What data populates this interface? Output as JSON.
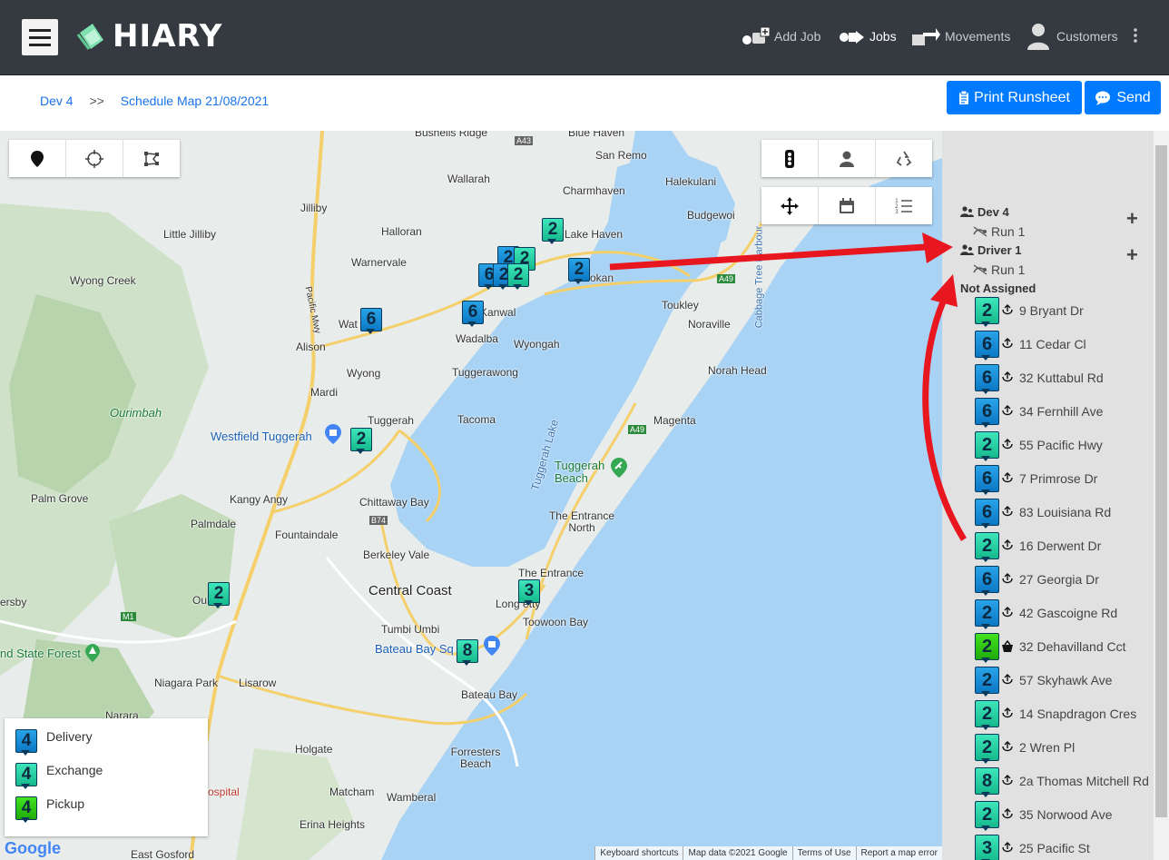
{
  "app": {
    "name": "HIARY"
  },
  "nav": {
    "add_job": "Add Job",
    "jobs": "Jobs",
    "movements": "Movements",
    "customers": "Customers"
  },
  "breadcrumb": {
    "parent": "Dev 4",
    "separator": ">>",
    "current": "Schedule Map 21/08/2021"
  },
  "actions": {
    "print": "Print Runsheet",
    "send": "Send"
  },
  "map": {
    "places": {
      "bushells_ridge": "Bushells Ridge",
      "blue_haven": "Blue Haven",
      "san_remo": "San Remo",
      "wallarah": "Wallarah",
      "charmhaven": "Charmhaven",
      "halekulani": "Halekulani",
      "jilliby": "Jilliby",
      "halloran": "Halloran",
      "lake_haven": "Lake Haven",
      "budgewoi": "Budgewoi",
      "little_jilliby": "Little Jilliby",
      "warnervale": "Warnervale",
      "wyong_creek": "Wyong Creek",
      "gorokan": "okan",
      "toukley": "Toukley",
      "watanobbi": "Wat   obbi",
      "kanwal": "Kanwal",
      "noraville": "Noraville",
      "alison": "Alison",
      "wadalba": "Wadalba",
      "wyongah": "Wyongah",
      "wyong": "Wyong",
      "tuggerawong": "Tuggerawong",
      "norah_head": "Norah Head",
      "mardi": "Mardi",
      "ourimbah": "Ourimbah",
      "tuggerah": "Tuggerah",
      "tacoma": "Tacoma",
      "magenta": "Magenta",
      "westfield": "Westfield Tuggerah",
      "tuggerah_beach": "Tuggerah Beach",
      "palm_grove": "Palm Grove",
      "kangy_angy": "Kangy Angy",
      "chittaway_bay": "Chittaway Bay",
      "palmdale": "Palmdale",
      "the_entrance_north": "The Entrance North",
      "fountaindale": "Fountaindale",
      "berkeley_vale": "Berkeley Vale",
      "the_entrance": "The Entrance",
      "central_coast": "Central Coast",
      "somersby": "ersby",
      "ourimbah2": "Ou      ah",
      "long_jetty": "Long    etty",
      "toowoon_bay": "Toowoon Bay",
      "tumbi_umbi": "Tumbi Umbi",
      "state_forest": "nd State Forest",
      "bateau_bay_square": "Bateau Bay Sq    e",
      "niagara_park": "Niagara Park",
      "lisarow": "Lisarow",
      "bateau_bay": "Bateau Bay",
      "narara": "Narara",
      "holgate": "Holgate",
      "forresters_beach": "Forresters Beach",
      "hospital": "ospital",
      "matcham": "Matcham",
      "wamberal": "Wamberal",
      "erina_heights": "Erina Heights",
      "east_gosford": "East Gosford",
      "tuggerah_lake": "Tuggerah Lake",
      "cabbage_tree": "Cabbage Tree Harbour",
      "pacific_mwy": "Pacific Mwy"
    },
    "roads": {
      "a43": "A43",
      "a49": "A49",
      "a49b": "A49",
      "b74": "B74",
      "m1": "M1"
    },
    "markers": [
      {
        "type": "e",
        "num": "2"
      },
      {
        "type": "d",
        "num": "2"
      },
      {
        "type": "e",
        "num": "2"
      },
      {
        "type": "d",
        "num": "6"
      },
      {
        "type": "d",
        "num": "6"
      },
      {
        "type": "d",
        "num": "6"
      },
      {
        "type": "e",
        "num": "2"
      },
      {
        "type": "e",
        "num": "2"
      },
      {
        "type": "e",
        "num": "3"
      },
      {
        "type": "e",
        "num": "8"
      },
      {
        "type": "d",
        "num": "2"
      },
      {
        "type": "d",
        "num": "6"
      }
    ],
    "legend": [
      {
        "type": "d",
        "num": "4",
        "label": "Delivery"
      },
      {
        "type": "e",
        "num": "4",
        "label": "Exchange"
      },
      {
        "type": "p",
        "num": "4",
        "label": "Pickup"
      }
    ],
    "attribution": {
      "google": "Google",
      "shortcuts": "Keyboard shortcuts",
      "data": "Map data ©2021 Google",
      "terms": "Terms of Use",
      "report": "Report a map error"
    }
  },
  "sidebar": {
    "groups": [
      {
        "name": "Dev 4",
        "run": "Run 1"
      },
      {
        "name": "Driver 1",
        "run": "Run 1"
      }
    ],
    "not_assigned": "Not Assigned",
    "jobs": [
      {
        "type": "e",
        "num": "2",
        "address": "9 Bryant Dr"
      },
      {
        "type": "d",
        "num": "6",
        "address": "11 Cedar Cl"
      },
      {
        "type": "d",
        "num": "6",
        "address": "32 Kuttabul Rd"
      },
      {
        "type": "d",
        "num": "6",
        "address": "34 Fernhill Ave"
      },
      {
        "type": "e",
        "num": "2",
        "address": "55 Pacific Hwy"
      },
      {
        "type": "d",
        "num": "6",
        "address": "7 Primrose Dr"
      },
      {
        "type": "d",
        "num": "6",
        "address": "83 Louisiana Rd"
      },
      {
        "type": "e",
        "num": "2",
        "address": "16 Derwent Dr"
      },
      {
        "type": "d",
        "num": "6",
        "address": "27 Georgia Dr"
      },
      {
        "type": "d",
        "num": "2",
        "address": "42 Gascoigne Rd"
      },
      {
        "type": "p",
        "num": "2",
        "address": "32 Dehavilland Cct"
      },
      {
        "type": "d",
        "num": "2",
        "address": "57 Skyhawk Ave"
      },
      {
        "type": "e",
        "num": "2",
        "address": "14 Snapdragon Cres"
      },
      {
        "type": "e",
        "num": "2",
        "address": "2 Wren Pl"
      },
      {
        "type": "e",
        "num": "8",
        "address": "2a Thomas Mitchell Rd"
      },
      {
        "type": "e",
        "num": "2",
        "address": "35 Norwood Ave"
      },
      {
        "type": "e",
        "num": "3",
        "address": "25 Pacific St"
      }
    ]
  },
  "colors": {
    "navbar": "#343a40",
    "primary": "#007bff",
    "link": "#1a73e8",
    "delivery": "#0c78c4",
    "exchange": "#15b98c",
    "pickup": "#1faa08",
    "annotation_arrow": "#e8161f"
  }
}
